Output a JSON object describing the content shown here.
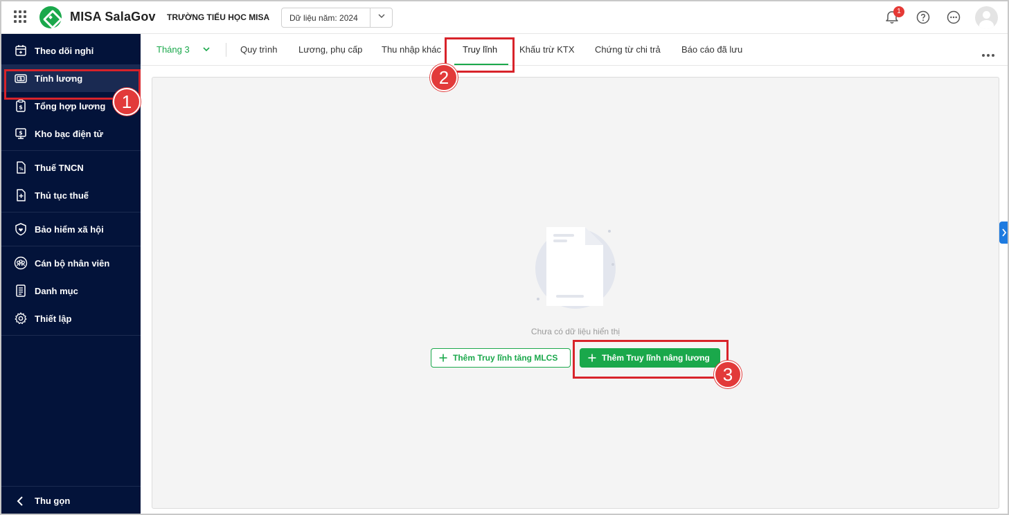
{
  "header": {
    "app_name": "MISA SalaGov",
    "org_name": "TRƯỜNG TIỂU HỌC MISA",
    "year_select": "Dữ liệu năm: 2024",
    "notification_count": "1"
  },
  "sidebar": {
    "groups": [
      {
        "items": [
          {
            "label": "Theo dõi nghỉ",
            "icon": "calendar-icon"
          },
          {
            "label": "Tính lương",
            "icon": "money-icon",
            "active": true
          },
          {
            "label": "Tổng hợp lương",
            "icon": "payroll-summary-icon"
          },
          {
            "label": "Kho bạc điện tử",
            "icon": "treasury-icon"
          }
        ]
      },
      {
        "items": [
          {
            "label": "Thuế TNCN",
            "icon": "tax-document-icon"
          },
          {
            "label": "Thủ tục thuế",
            "icon": "tax-procedure-icon"
          }
        ]
      },
      {
        "items": [
          {
            "label": "Bảo hiểm xã hội",
            "icon": "shield-heart-icon"
          }
        ]
      },
      {
        "items": [
          {
            "label": "Cán bộ nhân viên",
            "icon": "people-icon"
          },
          {
            "label": "Danh mục",
            "icon": "list-icon"
          },
          {
            "label": "Thiết lập",
            "icon": "gear-icon"
          }
        ]
      }
    ],
    "collapse_label": "Thu gọn"
  },
  "tabs": {
    "month": "Tháng 3",
    "items": [
      "Quy trình",
      "Lương, phụ cấp",
      "Thu nhập khác",
      "Truy lĩnh",
      "Khấu trừ KTX",
      "Chứng từ chi trả",
      "Báo cáo đã lưu"
    ],
    "active": "Truy lĩnh"
  },
  "content": {
    "empty_text": "Chưa có dữ liệu hiển thị",
    "btn_add_mlcs": "Thêm Truy lĩnh tăng MLCS",
    "btn_add_salary": "Thêm Truy lĩnh nâng lương"
  },
  "annotations": [
    "1",
    "2",
    "3"
  ],
  "colors": {
    "brand_green": "#1aa84b",
    "sidebar_bg": "#03133a",
    "highlight_red": "#d8232a",
    "marker_red": "#e23a3a",
    "toggle_blue": "#1e7be0"
  }
}
